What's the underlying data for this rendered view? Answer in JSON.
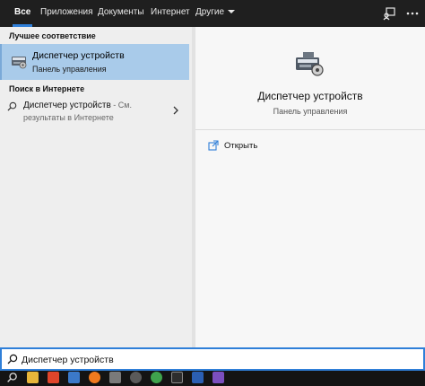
{
  "tabs": [
    {
      "label": "Все"
    },
    {
      "label": "Приложения"
    },
    {
      "label": "Документы"
    },
    {
      "label": "Интернет"
    },
    {
      "label": "Другие"
    }
  ],
  "left": {
    "best_match_header": "Лучшее соответствие",
    "best_match": {
      "title": "Диспетчер устройств",
      "subtitle": "Панель управления"
    },
    "web_header": "Поиск в Интернете",
    "web_result": {
      "title": "Диспетчер устройств",
      "suffix": " - См.",
      "line2": "результаты в Интернете"
    }
  },
  "preview": {
    "title": "Диспетчер устройств",
    "subtitle": "Панель управления",
    "actions": [
      {
        "label": "Открыть"
      }
    ]
  },
  "search": {
    "value": "Диспетчер устройств"
  },
  "colors": {
    "accent": "#2f7fd8",
    "selected": "#a9cbea",
    "topbar": "#1f1f1f"
  },
  "taskbar_icons": [
    "search-icon",
    "file-explorer-icon",
    "brave-icon",
    "store-icon",
    "firefox-icon",
    "chat-icon",
    "settings-icon",
    "utorrent-icon",
    "terminal-icon",
    "word-icon",
    "visual-studio-icon"
  ]
}
